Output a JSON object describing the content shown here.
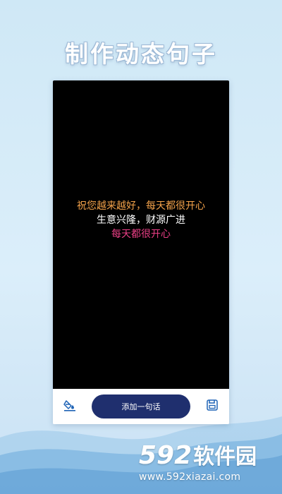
{
  "headline": "制作动态句子",
  "preview": {
    "sentences": [
      {
        "text": "祝您越来越好，每天都很开心",
        "color": "#f3a24a"
      },
      {
        "text": "生意兴隆，财源广进",
        "color": "#ffffff"
      },
      {
        "text": "每天都很开心",
        "color": "#ea3f86"
      }
    ]
  },
  "toolbar": {
    "add_label": "添加一句话",
    "left_icon": "paint-bucket-icon",
    "right_icon": "save-icon"
  },
  "brand": {
    "number": "592",
    "name": "软件园",
    "url": "www.592xiazai.com"
  },
  "colors": {
    "button": "#1f2f6e",
    "accent_blue": "#1d62b5",
    "background": "#d7ecf8"
  }
}
